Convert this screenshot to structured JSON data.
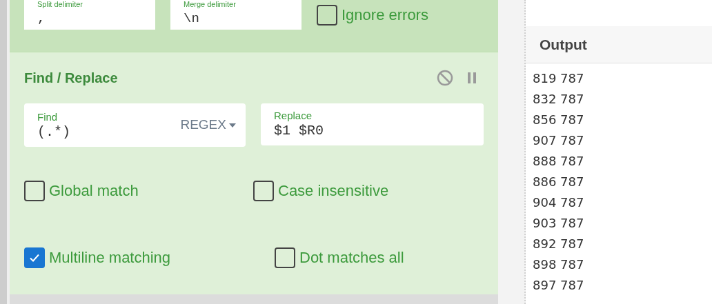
{
  "split_operation": {
    "fields": [
      {
        "label": "Split delimiter",
        "value": ","
      },
      {
        "label": "Merge delimiter",
        "value": "\\n"
      }
    ],
    "ignore_errors": {
      "label": "Ignore errors",
      "checked": false
    }
  },
  "find_replace": {
    "title": "Find / Replace",
    "find": {
      "label": "Find",
      "value": "(.*)",
      "mode": "REGEX"
    },
    "replace": {
      "label": "Replace",
      "value": "$1 $R0"
    },
    "options": [
      {
        "label": "Global match",
        "checked": false
      },
      {
        "label": "Case insensitive",
        "checked": false
      },
      {
        "label": "Multiline matching",
        "checked": true
      },
      {
        "label": "Dot matches all",
        "checked": false
      }
    ]
  },
  "output": {
    "title": "Output",
    "lines": [
      "819 787",
      "832 787",
      "856 787",
      "907 787",
      "888 787",
      "886 787",
      "904 787",
      "903 787",
      "892 787",
      "898 787",
      "897 787"
    ]
  }
}
